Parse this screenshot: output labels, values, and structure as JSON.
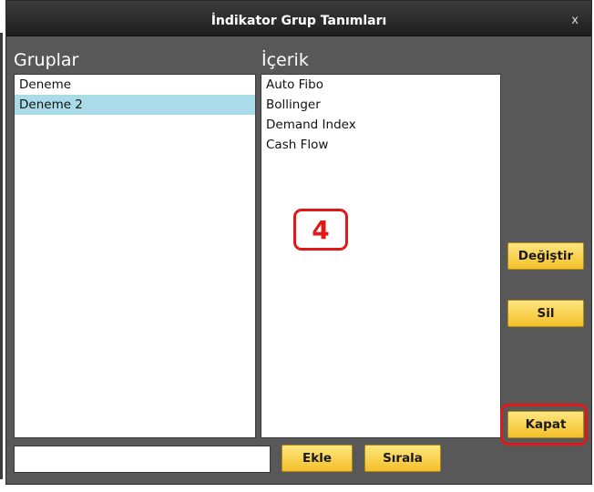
{
  "window": {
    "title": "İndikator Grup Tanımları",
    "close_label": "x"
  },
  "groups": {
    "label": "Gruplar",
    "items": [
      {
        "label": "Deneme",
        "selected": false
      },
      {
        "label": "Deneme 2",
        "selected": true
      }
    ]
  },
  "contents": {
    "label": "İçerik",
    "items": [
      {
        "label": "Auto Fibo"
      },
      {
        "label": "Bollinger"
      },
      {
        "label": "Demand Index"
      },
      {
        "label": "Cash Flow"
      }
    ]
  },
  "buttons": {
    "change": "Değiştir",
    "delete": "Sil",
    "close": "Kapat",
    "add": "Ekle",
    "sort": "Sırala"
  },
  "new_group_input": {
    "value": "",
    "placeholder": ""
  },
  "annotation": {
    "number": "4",
    "color": "#e01818"
  },
  "colors": {
    "accent_button": "#f4c02a",
    "selected_row": "#aadbe9",
    "dialog_bg": "#585858"
  }
}
